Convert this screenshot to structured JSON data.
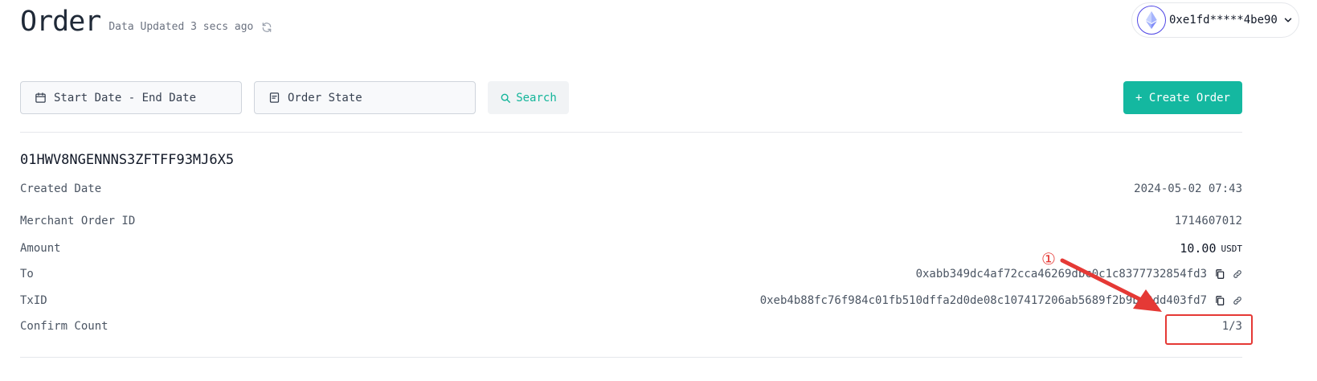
{
  "header": {
    "title": "Order",
    "updated_label": "Data Updated 3 secs ago",
    "wallet_address": "0xe1fd*****4be90"
  },
  "filters": {
    "date_range_label": "Start Date - End Date",
    "order_state_label": "Order State",
    "search_label": "Search",
    "create_label": "+ Create Order"
  },
  "order": {
    "id": "01HWV8NGENNNS3ZFTFF93MJ6X5",
    "fields": {
      "created_date": {
        "key": "Created Date",
        "value": "2024-05-02 07:43"
      },
      "merchant_order_id": {
        "key": "Merchant Order ID",
        "value": "1714607012"
      },
      "amount": {
        "key": "Amount",
        "value": "10.00",
        "unit": "USDT"
      },
      "to": {
        "key": "To",
        "value": "0xabb349dc4af72cca46269dbc0c1c8377732854fd3"
      },
      "txid": {
        "key": "TxID",
        "value": "0xeb4b88fc76f984c01fb510dffa2d0de08c107417206ab5689f2b9bc0dd403fd7"
      },
      "confirm_count": {
        "key": "Confirm Count",
        "value": "1/3"
      }
    }
  },
  "annotation": {
    "marker": "①"
  },
  "icons": {
    "refresh": "refresh-icon",
    "ethereum": "ethereum-icon",
    "chevron": "chevron-down-icon",
    "calendar": "calendar-icon",
    "order_state": "list-icon",
    "search": "search-icon",
    "copy": "copy-icon",
    "link": "link-icon"
  },
  "colors": {
    "accent": "#14b8a0",
    "search_text": "#13b59a",
    "annotation": "#e53935",
    "eth_ring": "#4f46e5"
  }
}
